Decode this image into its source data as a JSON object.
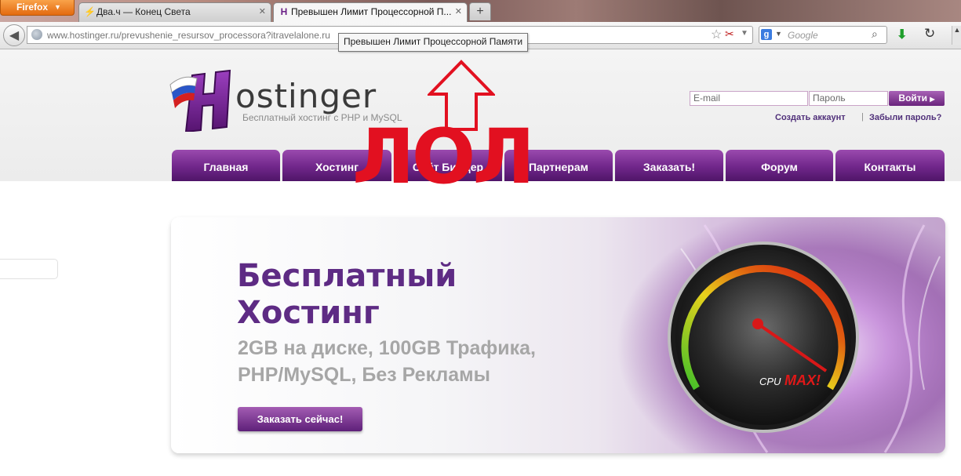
{
  "browser": {
    "menu_button": "Firefox",
    "tabs": [
      {
        "title": "Два.ч — Конец Света",
        "active": false
      },
      {
        "title": "Превышен Лимит Процессорной П...",
        "active": true
      }
    ],
    "new_tab": "+",
    "url": {
      "host": "www.hostinger.ru",
      "path": "/prevushenie_resursov_processora?itravelalone.ru"
    },
    "search_placeholder": "Google",
    "search_engine": "g",
    "tooltip": "Превышен Лимит Процессорной Памяти"
  },
  "site": {
    "logo_text": "ostinger",
    "logo_letter": "H",
    "tagline": "Бесплатный хостинг с PHP и MySQL",
    "login": {
      "email_placeholder": "E-mail",
      "password_placeholder": "Пароль",
      "submit": "Войти",
      "create_account": "Создать аккаунт",
      "separator": "|",
      "forgot_password": "Забыли пароль?"
    },
    "nav": [
      "Главная",
      "Хостинг",
      "Сайт Билдер",
      "Партнерам",
      "Заказать!",
      "Форум",
      "Контакты"
    ],
    "banner": {
      "title_line1": "Бесплатный",
      "title_line2": "Хостинг",
      "subtitle_line1": "2GB на диске, 100GB Трафика,",
      "subtitle_line2": "PHP/MySQL, Без Рекламы",
      "cta": "Заказать сейчас!",
      "gauge_label_cpu": "CPU",
      "gauge_label_max": "MAX!"
    }
  },
  "overlay": {
    "text": "ЛОЛ",
    "color": "#e21020"
  },
  "colors": {
    "brand_purple": "#5e2b84",
    "nav_purple": "#70268a",
    "firefox_orange": "#e36a0f"
  }
}
